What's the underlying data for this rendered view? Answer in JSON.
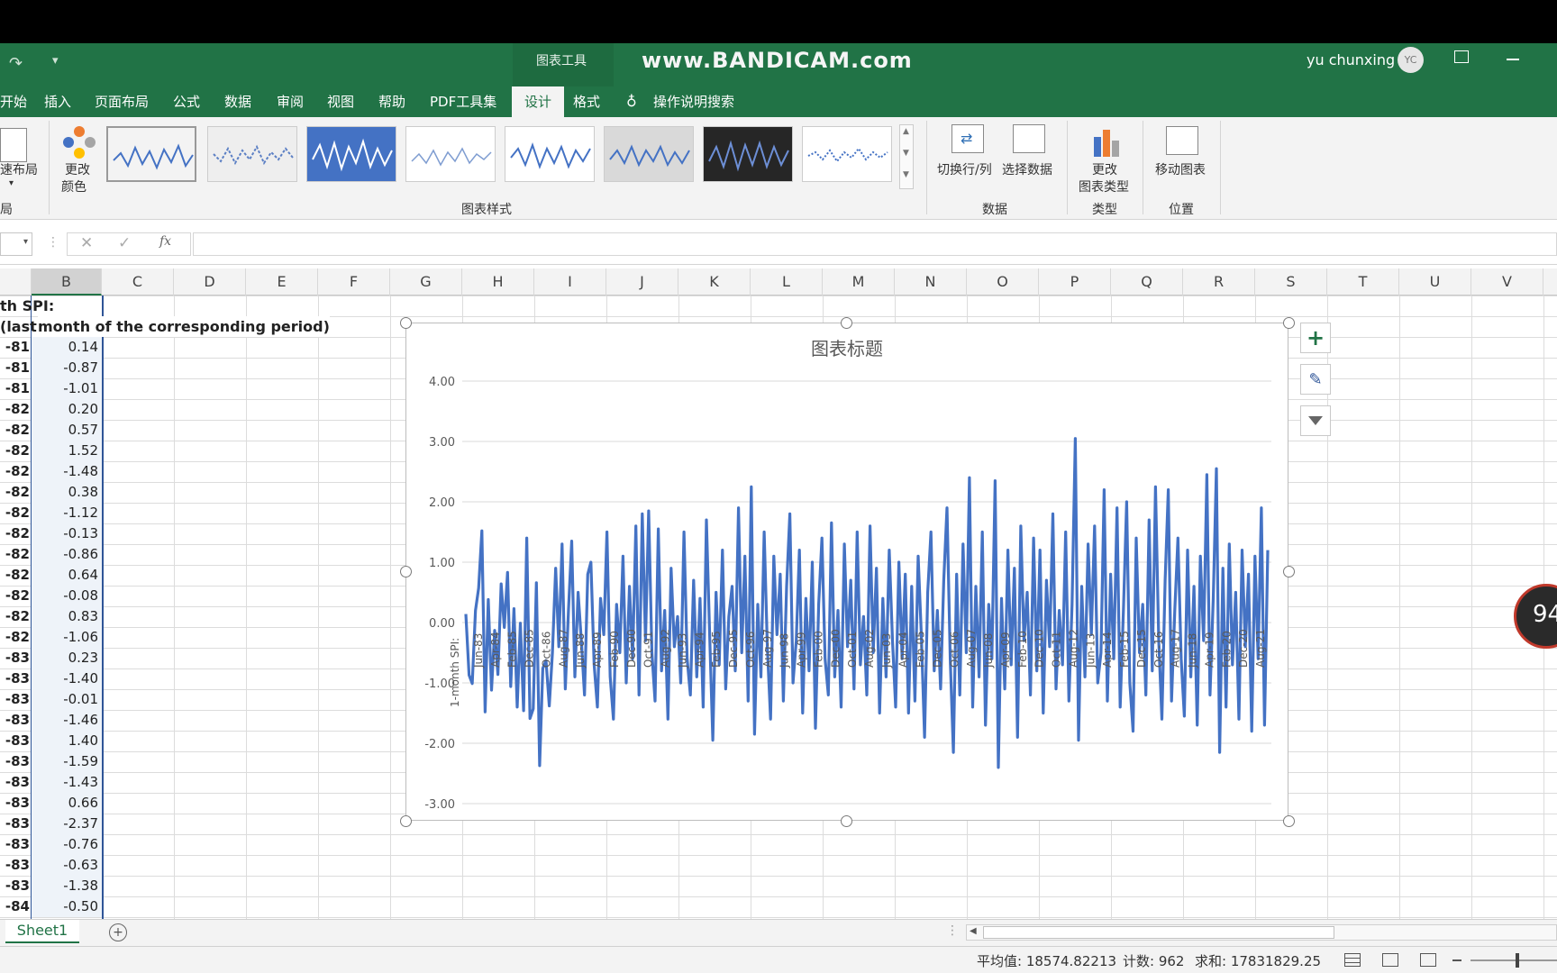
{
  "watermark": "www.BANDICAM.com",
  "titlebar": {
    "tool_context": "图表工具",
    "user_name": "yu chunxing",
    "user_initials": "YC"
  },
  "tabs": {
    "home_partial": "开始",
    "insert": "插入",
    "page_layout": "页面布局",
    "formulas": "公式",
    "data": "数据",
    "review": "审阅",
    "view": "视图",
    "help": "帮助",
    "pdf": "PDF工具集",
    "design": "设计",
    "format": "格式",
    "tell_me": "操作说明搜索"
  },
  "ribbon": {
    "quick_layout": "速布局",
    "change_colors": "更改",
    "change_colors_2": "颜色",
    "styles_group": "图表样式",
    "switch_row_col": "切换行/列",
    "select_data": "选择数据",
    "data_group": "数据",
    "change_type": "更改",
    "change_type_2": "图表类型",
    "type_group": "类型",
    "move_chart": "移动图表",
    "location_group": "位置",
    "layouts_group_partial": "局"
  },
  "formula_bar": {
    "fx": "fx",
    "value": ""
  },
  "columns": [
    "B",
    "C",
    "D",
    "E",
    "F",
    "G",
    "H",
    "I",
    "J",
    "K",
    "L",
    "M",
    "N",
    "O",
    "P",
    "Q",
    "R",
    "S",
    "T",
    "U",
    "V"
  ],
  "sheet": {
    "header_a1": "th SPI:",
    "header_a2": "(last",
    "header_b2": "month of the corresponding period)",
    "rows": [
      {
        "a": "-81",
        "b": "0.14"
      },
      {
        "a": "-81",
        "b": "-0.87"
      },
      {
        "a": "-81",
        "b": "-1.01"
      },
      {
        "a": "-82",
        "b": "0.20"
      },
      {
        "a": "-82",
        "b": "0.57"
      },
      {
        "a": "-82",
        "b": "1.52"
      },
      {
        "a": "-82",
        "b": "-1.48"
      },
      {
        "a": "-82",
        "b": "0.38"
      },
      {
        "a": "-82",
        "b": "-1.12"
      },
      {
        "a": "-82",
        "b": "-0.13"
      },
      {
        "a": "-82",
        "b": "-0.86"
      },
      {
        "a": "-82",
        "b": "0.64"
      },
      {
        "a": "-82",
        "b": "-0.08"
      },
      {
        "a": "-82",
        "b": "0.83"
      },
      {
        "a": "-82",
        "b": "-1.06"
      },
      {
        "a": "-83",
        "b": "0.23"
      },
      {
        "a": "-83",
        "b": "-1.40"
      },
      {
        "a": "-83",
        "b": "-0.01"
      },
      {
        "a": "-83",
        "b": "-1.46"
      },
      {
        "a": "-83",
        "b": "1.40"
      },
      {
        "a": "-83",
        "b": "-1.59"
      },
      {
        "a": "-83",
        "b": "-1.43"
      },
      {
        "a": "-83",
        "b": "0.66"
      },
      {
        "a": "-83",
        "b": "-2.37"
      },
      {
        "a": "-83",
        "b": "-0.76"
      },
      {
        "a": "-83",
        "b": "-0.63"
      },
      {
        "a": "-83",
        "b": "-1.38"
      },
      {
        "a": "-84",
        "b": "-0.50"
      }
    ],
    "tab_name": "Sheet1"
  },
  "chart_data": {
    "type": "line",
    "title": "图表标题",
    "series_label": "1-month SPI:",
    "ylim": [
      -3,
      4
    ],
    "yticks": [
      "4.00",
      "3.00",
      "2.00",
      "1.00",
      "0.00",
      "-1.00",
      "-2.00",
      "-3.00"
    ],
    "xtick_labels": [
      "Jun-83",
      "Apr-84",
      "Feb-85",
      "Dec-85",
      "Oct-86",
      "Aug-87",
      "Jun-88",
      "Apr-89",
      "Feb-90",
      "Dec-90",
      "Oct-91",
      "Aug-92",
      "Jun-93",
      "Apr-94",
      "Feb-95",
      "Dec-95",
      "Oct-96",
      "Aug-97",
      "Jun-98",
      "Apr-99",
      "Feb-00",
      "Dec-00",
      "Oct-01",
      "Aug-02",
      "Jun-03",
      "Apr-04",
      "Feb-05",
      "Dec-05",
      "Oct-06",
      "Aug-07",
      "Jun-08",
      "Apr-09",
      "Feb-10",
      "Dec-10",
      "Oct-11",
      "Aug-12",
      "Jun-13",
      "Apr-14",
      "Feb-15",
      "Dec-15",
      "Oct-16",
      "Aug-17",
      "Jun-18",
      "Apr-19",
      "Feb-20",
      "Dec-20",
      "Aug-21"
    ],
    "values": [
      0.14,
      -0.87,
      -1.01,
      0.2,
      0.57,
      1.52,
      -1.48,
      0.38,
      -1.12,
      -0.13,
      -0.86,
      0.64,
      -0.08,
      0.83,
      -1.06,
      0.23,
      -1.4,
      -0.01,
      -1.46,
      1.4,
      -1.59,
      -1.43,
      0.66,
      -2.37,
      -0.76,
      -0.63,
      -1.38,
      -0.5,
      0.9,
      -0.4,
      1.3,
      -1.1,
      0.2,
      1.35,
      -0.9,
      0.5,
      -0.3,
      -1.2,
      0.8,
      1.0,
      -0.7,
      -1.4,
      0.4,
      -0.2,
      1.5,
      -0.9,
      -1.6,
      0.3,
      -0.5,
      1.1,
      -1.0,
      0.6,
      -0.6,
      1.6,
      -1.2,
      1.8,
      -0.3,
      1.85,
      -0.5,
      -1.3,
      1.55,
      -0.8,
      0.2,
      -1.6,
      0.9,
      -0.4,
      0.1,
      -1.0,
      1.5,
      -0.6,
      -1.2,
      0.7,
      -0.9,
      0.4,
      -1.4,
      1.7,
      -0.2,
      -1.95,
      0.5,
      -0.7,
      1.2,
      -1.1,
      0.1,
      0.6,
      -0.8,
      1.9,
      -0.5,
      1.1,
      -1.3,
      2.25,
      -1.85,
      0.3,
      -0.9,
      1.5,
      -0.4,
      -1.6,
      1.1,
      -0.2,
      0.8,
      -1.3,
      0.6,
      1.8,
      -1.0,
      -0.3,
      1.2,
      -1.5,
      0.4,
      -0.8,
      1.0,
      -1.75,
      0.3,
      1.4,
      -0.6,
      -1.2,
      1.65,
      -0.9,
      0.2,
      -1.4,
      1.3,
      -0.4,
      0.7,
      -1.1,
      1.5,
      -0.7,
      0.1,
      -1.2,
      1.6,
      -0.5,
      0.9,
      -1.5,
      0.4,
      -0.9,
      1.2,
      -0.3,
      -1.4,
      1.0,
      -0.6,
      0.8,
      -1.5,
      0.6,
      -1.3,
      1.1,
      -0.2,
      -1.9,
      0.5,
      1.5,
      -0.8,
      0.2,
      -1.1,
      0.7,
      1.9,
      -0.6,
      -2.15,
      0.8,
      -1.2,
      1.3,
      -0.5,
      2.4,
      -1.4,
      0.6,
      -0.9,
      1.5,
      -1.7,
      0.3,
      -0.6,
      2.35,
      -2.4,
      0.4,
      -1.1,
      1.2,
      -0.7,
      0.9,
      -1.9,
      1.6,
      -0.3,
      0.5,
      -1.2,
      1.4,
      -0.8,
      1.2,
      -1.5,
      0.7,
      -0.4,
      1.8,
      -1.1,
      0.2,
      -0.7,
      1.5,
      -1.3,
      0.3,
      3.05,
      -1.95,
      0.6,
      -0.9,
      1.3,
      -0.2,
      1.6,
      -1.0,
      -0.5,
      2.2,
      -1.3,
      0.8,
      -0.6,
      1.9,
      -1.4,
      0.2,
      2.0,
      -1.0,
      -1.8,
      1.4,
      -0.5,
      0.3,
      -1.2,
      1.7,
      -0.8,
      2.25,
      -0.3,
      -1.6,
      0.7,
      2.2,
      -1.3,
      0.2,
      1.4,
      -0.6,
      -1.55,
      1.2,
      -0.9,
      0.6,
      -1.7,
      1.1,
      -0.3,
      2.45,
      -1.2,
      0.4,
      2.55,
      -2.15,
      0.9,
      -1.4,
      1.3,
      -0.7,
      0.5,
      -1.6,
      1.2,
      -0.4,
      0.8,
      -1.8,
      1.1,
      -0.6,
      1.9,
      -1.7,
      1.2
    ]
  },
  "status": {
    "average": "平均值: 18574.82213",
    "count": "计数: 962",
    "sum": "求和: 17831829.25"
  },
  "side_badge": "94",
  "colors": {
    "excel_green": "#217346",
    "series": "#4472c4"
  }
}
